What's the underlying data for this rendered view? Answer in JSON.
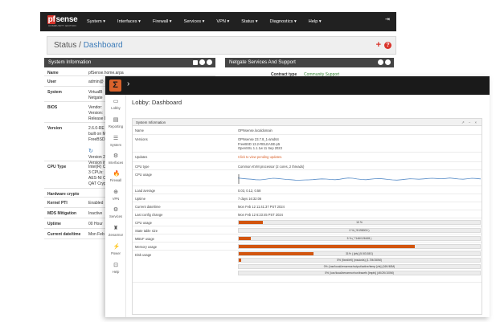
{
  "pfsense": {
    "logo_name_p": "pf",
    "logo_name_rest": "sense",
    "logo_edition": "COMMUNITY EDITION",
    "menu": [
      "System ▾",
      "Interfaces ▾",
      "Firewall ▾",
      "Services ▾",
      "VPN ▾",
      "Status ▾",
      "Diagnostics ▾",
      "Help ▾"
    ],
    "breadcrumb_status": "Status /",
    "breadcrumb_page": "Dashboard",
    "system_info_title": "System Information",
    "netgate_title": "Netgate Services And Support",
    "contract_label": "Contract type",
    "contract_value": "Community Support",
    "rows": [
      {
        "k": "Name",
        "v": [
          "pfSense.home.arpa"
        ]
      },
      {
        "k": "User",
        "v": [
          "admin@"
        ]
      },
      {
        "k": "System",
        "v": [
          "VirtualB",
          "Netgate"
        ]
      },
      {
        "k": "BIOS",
        "v": [
          "Vendor: ",
          "Version:",
          "Release D"
        ]
      },
      {
        "k": "Version",
        "v": [
          "2.6.0-RE",
          "built on M",
          "FreeBSD",
          "",
          "Version 2",
          "Version in"
        ]
      },
      {
        "k": "CPU Type",
        "v": [
          "Intel(R) C",
          "3 CPUs: ",
          "AES-NI C",
          "QAT Cryp"
        ]
      },
      {
        "k": "Hardware crypto",
        "v": [
          ""
        ]
      },
      {
        "k": "Kernel PTI",
        "v": [
          "Enabled"
        ]
      },
      {
        "k": "MDS Mitigation",
        "v": [
          "Inactive"
        ]
      },
      {
        "k": "Uptime",
        "v": [
          "00 Hour"
        ]
      },
      {
        "k": "Current date/time",
        "v": [
          "Mon Feb"
        ]
      }
    ]
  },
  "opnsense": {
    "logo_glyph": "Σ",
    "page_title": "Lobby: Dashboard",
    "panel_title": "System Information",
    "panel_controls": "↗ − ×",
    "sidebar": [
      {
        "icon": "▭",
        "label": "Lobby"
      },
      {
        "icon": "▤",
        "label": "Reporting"
      },
      {
        "icon": "☰",
        "label": "System"
      },
      {
        "icon": "⚙",
        "label": "Interfaces"
      },
      {
        "icon": "🔥",
        "label": "Firewall"
      },
      {
        "icon": "⊕",
        "label": "VPN"
      },
      {
        "icon": "⚙",
        "label": "Services"
      },
      {
        "icon": "♜",
        "label": "Zenarmor"
      },
      {
        "icon": "⚡",
        "label": "Power"
      },
      {
        "icon": "⊡",
        "label": "Help"
      }
    ],
    "rows": [
      {
        "k": "Name",
        "v": [
          "OPNsense.localdomain"
        ]
      },
      {
        "k": "Versions",
        "v": [
          "OPNsense 23.7.8_1-amd64",
          "FreeBSD 13.2-RELEASE-p5",
          "OpenSSL 1.1.1w 11 Sep 2023"
        ]
      },
      {
        "k": "Updates",
        "v": [
          "Click to view pending updates."
        ],
        "link": true
      },
      {
        "k": "CPU type",
        "v": [
          "Common KVM processor (2 cores, 2 threads)"
        ]
      },
      {
        "k": "CPU usage",
        "v": []
      },
      {
        "k": "Load average",
        "v": [
          "0.03, 0.12, 0.58"
        ]
      },
      {
        "k": "Uptime",
        "v": [
          "7 days 16:32:06"
        ]
      },
      {
        "k": "Current date/time",
        "v": [
          "Mon Feb 12 11:41:37 PST 2024"
        ]
      },
      {
        "k": "Last config change",
        "v": [
          "Mon Feb 12 6:23:45 PST 2024"
        ]
      },
      {
        "k": "CPU usage",
        "v": []
      },
      {
        "k": "State table size",
        "v": []
      },
      {
        "k": "MBUF usage",
        "v": []
      },
      {
        "k": "Memory usage",
        "v": []
      },
      {
        "k": "Disk usage",
        "v": []
      }
    ],
    "bars": {
      "cpu": {
        "pct": 10,
        "text": "10 %"
      },
      "state": {
        "pct": 0,
        "text": "0 % ( 9/198000 )"
      },
      "mbuf": {
        "pct": 5,
        "text": "5 % ( 7146/126165 )"
      },
      "memory": {
        "pct": 73,
        "text": ""
      },
      "disk": [
        {
          "pct": 31,
          "text": "31% ( [zfs] (5.5G/18G)"
        },
        {
          "pct": 1,
          "text": "0% (fixed/efi) (msdosfs) (1.7M/150M)"
        },
        {
          "pct": 0,
          "text": "0% (/usr/local/zenarmor/output/active/temp [zfs] (16K/48M)"
        },
        {
          "pct": 0,
          "text": "0% (/usr/local/zenarmor/run/tracefs [tmpfs] (4K/2K/100M)"
        }
      ]
    },
    "cpu_graph": [
      62,
      58,
      55,
      52,
      48,
      47,
      50,
      56,
      60,
      58,
      54,
      50,
      48,
      45,
      44,
      46,
      47,
      49,
      52,
      55,
      53,
      50,
      48,
      51,
      58,
      62,
      60,
      54,
      50,
      48,
      52,
      56,
      58,
      55,
      50,
      47,
      45,
      48,
      52,
      56,
      54,
      52,
      55,
      58,
      60,
      58,
      56,
      58,
      62,
      58,
      54,
      52,
      56,
      60,
      58,
      55
    ]
  }
}
